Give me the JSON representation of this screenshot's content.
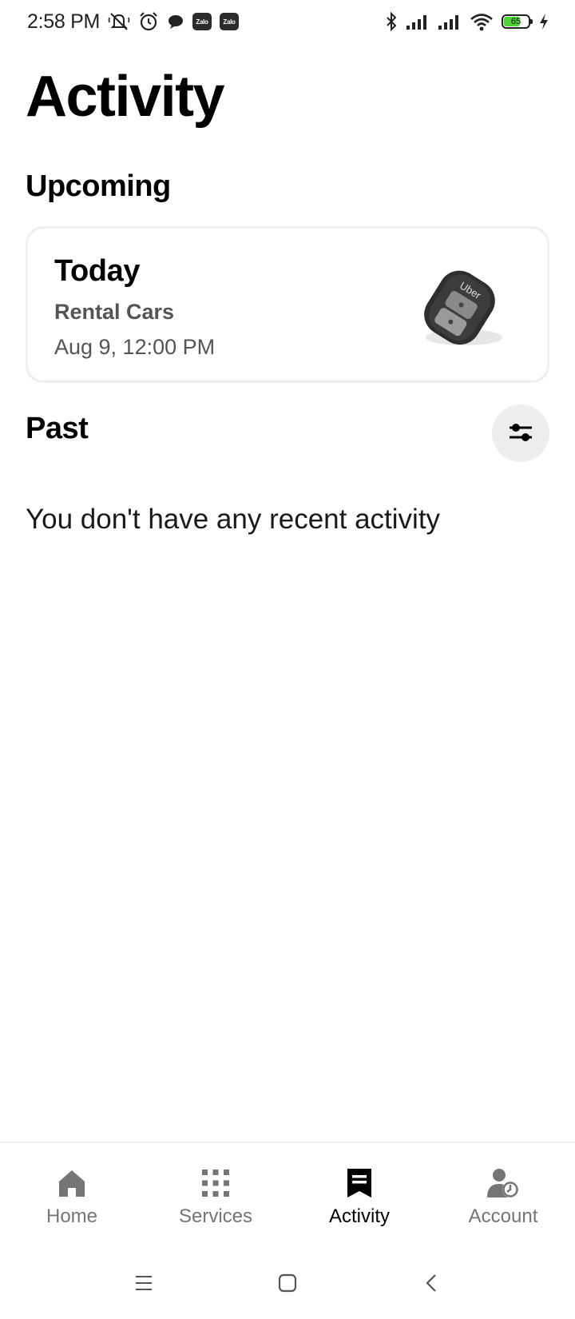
{
  "status_bar": {
    "time": "2:58 PM",
    "notification_icons": [
      "muted-bell-icon",
      "alarm-icon",
      "chat-bubble-icon",
      "zalo-icon",
      "zalo-icon"
    ],
    "zalo_label": "Zalo",
    "battery_level": "65",
    "system_icons": [
      "bluetooth-icon",
      "signal-icon",
      "signal-icon",
      "wifi-icon",
      "battery-icon",
      "charging-icon"
    ]
  },
  "page": {
    "title": "Activity"
  },
  "upcoming": {
    "heading": "Upcoming",
    "trip": {
      "day": "Today",
      "service": "Rental Cars",
      "datetime": "Aug 9, 12:00 PM",
      "fob_brand": "Uber"
    }
  },
  "past": {
    "heading": "Past",
    "filter_icon": "sliders-icon",
    "empty_message": "You don't have any recent activity"
  },
  "bottom_nav": {
    "items": [
      {
        "label": "Home",
        "icon": "home-icon",
        "active": false
      },
      {
        "label": "Services",
        "icon": "grid-icon",
        "active": false
      },
      {
        "label": "Activity",
        "icon": "receipt-icon",
        "active": true
      },
      {
        "label": "Account",
        "icon": "account-icon",
        "active": false
      }
    ]
  },
  "system_nav": [
    "menu-icon",
    "home-square-icon",
    "back-icon"
  ],
  "colors": {
    "text_primary": "#000000",
    "text_secondary": "#545454",
    "nav_inactive": "#757575",
    "card_border": "#eeeeee",
    "battery_fill": "#4cd437"
  }
}
